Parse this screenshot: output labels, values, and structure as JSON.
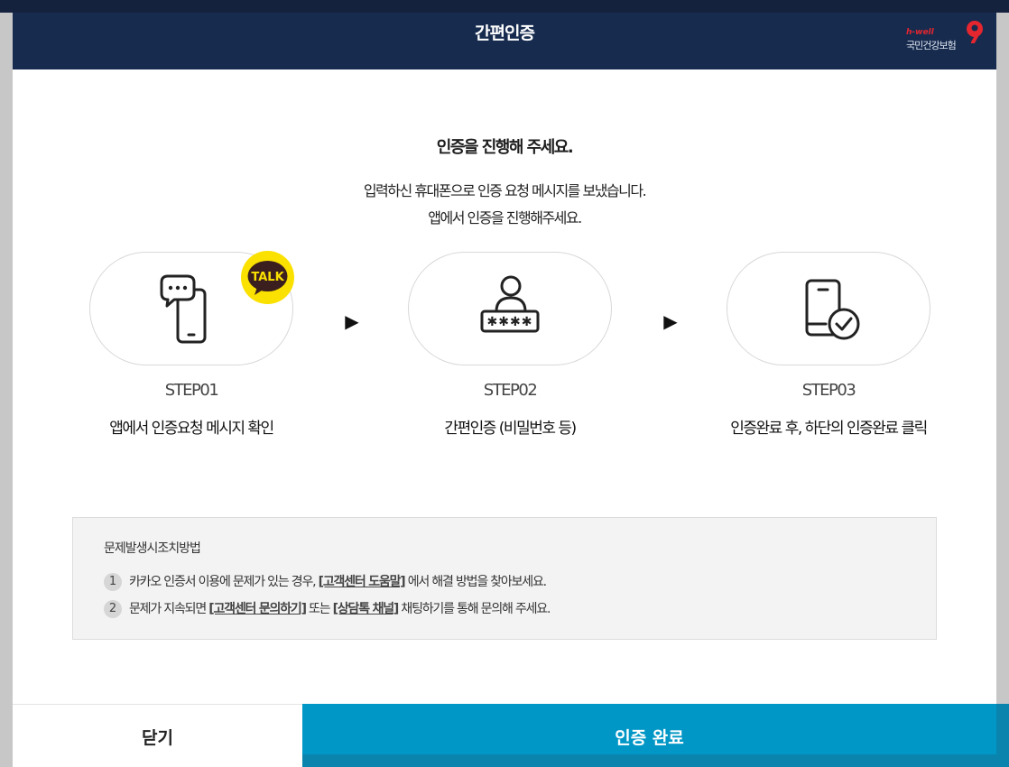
{
  "header": {
    "title": "간편인증",
    "brand": {
      "small_text": "h-well",
      "name": "국민건강보험",
      "mark_icon": "nhis-logo-icon",
      "mark_color": "#e4262f"
    }
  },
  "main": {
    "heading": "인증을 진행해 주세요.",
    "description_line1": "입력하신 휴대폰으로 인증 요청 메시지를 보냈습니다.",
    "description_line2": "앱에서 인증을 진행해주세요."
  },
  "steps": [
    {
      "label": "STEP01",
      "desc": "앱에서 인증요청 메시지 확인",
      "icon": "phone-chat-icon",
      "badge": "TALK",
      "badge_color": "#fae100"
    },
    {
      "label": "STEP02",
      "desc": "간편인증 (비밀번호 등)",
      "icon": "user-password-icon"
    },
    {
      "label": "STEP03",
      "desc": "인증완료 후, 하단의 인증완료 클릭",
      "icon": "phone-check-icon"
    }
  ],
  "arrows": [
    "▶",
    "▶"
  ],
  "help": {
    "title": "문제발생시조치방법",
    "items": [
      {
        "num": "1",
        "pre": "카카오 인증서 이용에 문제가 있는 경우, ",
        "link": "[고객센터 도움말]",
        "post": " 에서 해결 방법을 찾아보세요."
      },
      {
        "num": "2",
        "pre": "문제가 지속되면 ",
        "link1": "[고객센터 문의하기]",
        "mid": " 또는 ",
        "link2": "[상담톡 채널]",
        "post": " 채팅하기를 통해 문의해 주세요."
      }
    ]
  },
  "footer": {
    "close_label": "닫기",
    "confirm_label": "인증 완료",
    "confirm_color": "#0097c6"
  },
  "colors": {
    "header_bg": "#172b4f",
    "help_bg": "#f3f3f3"
  }
}
